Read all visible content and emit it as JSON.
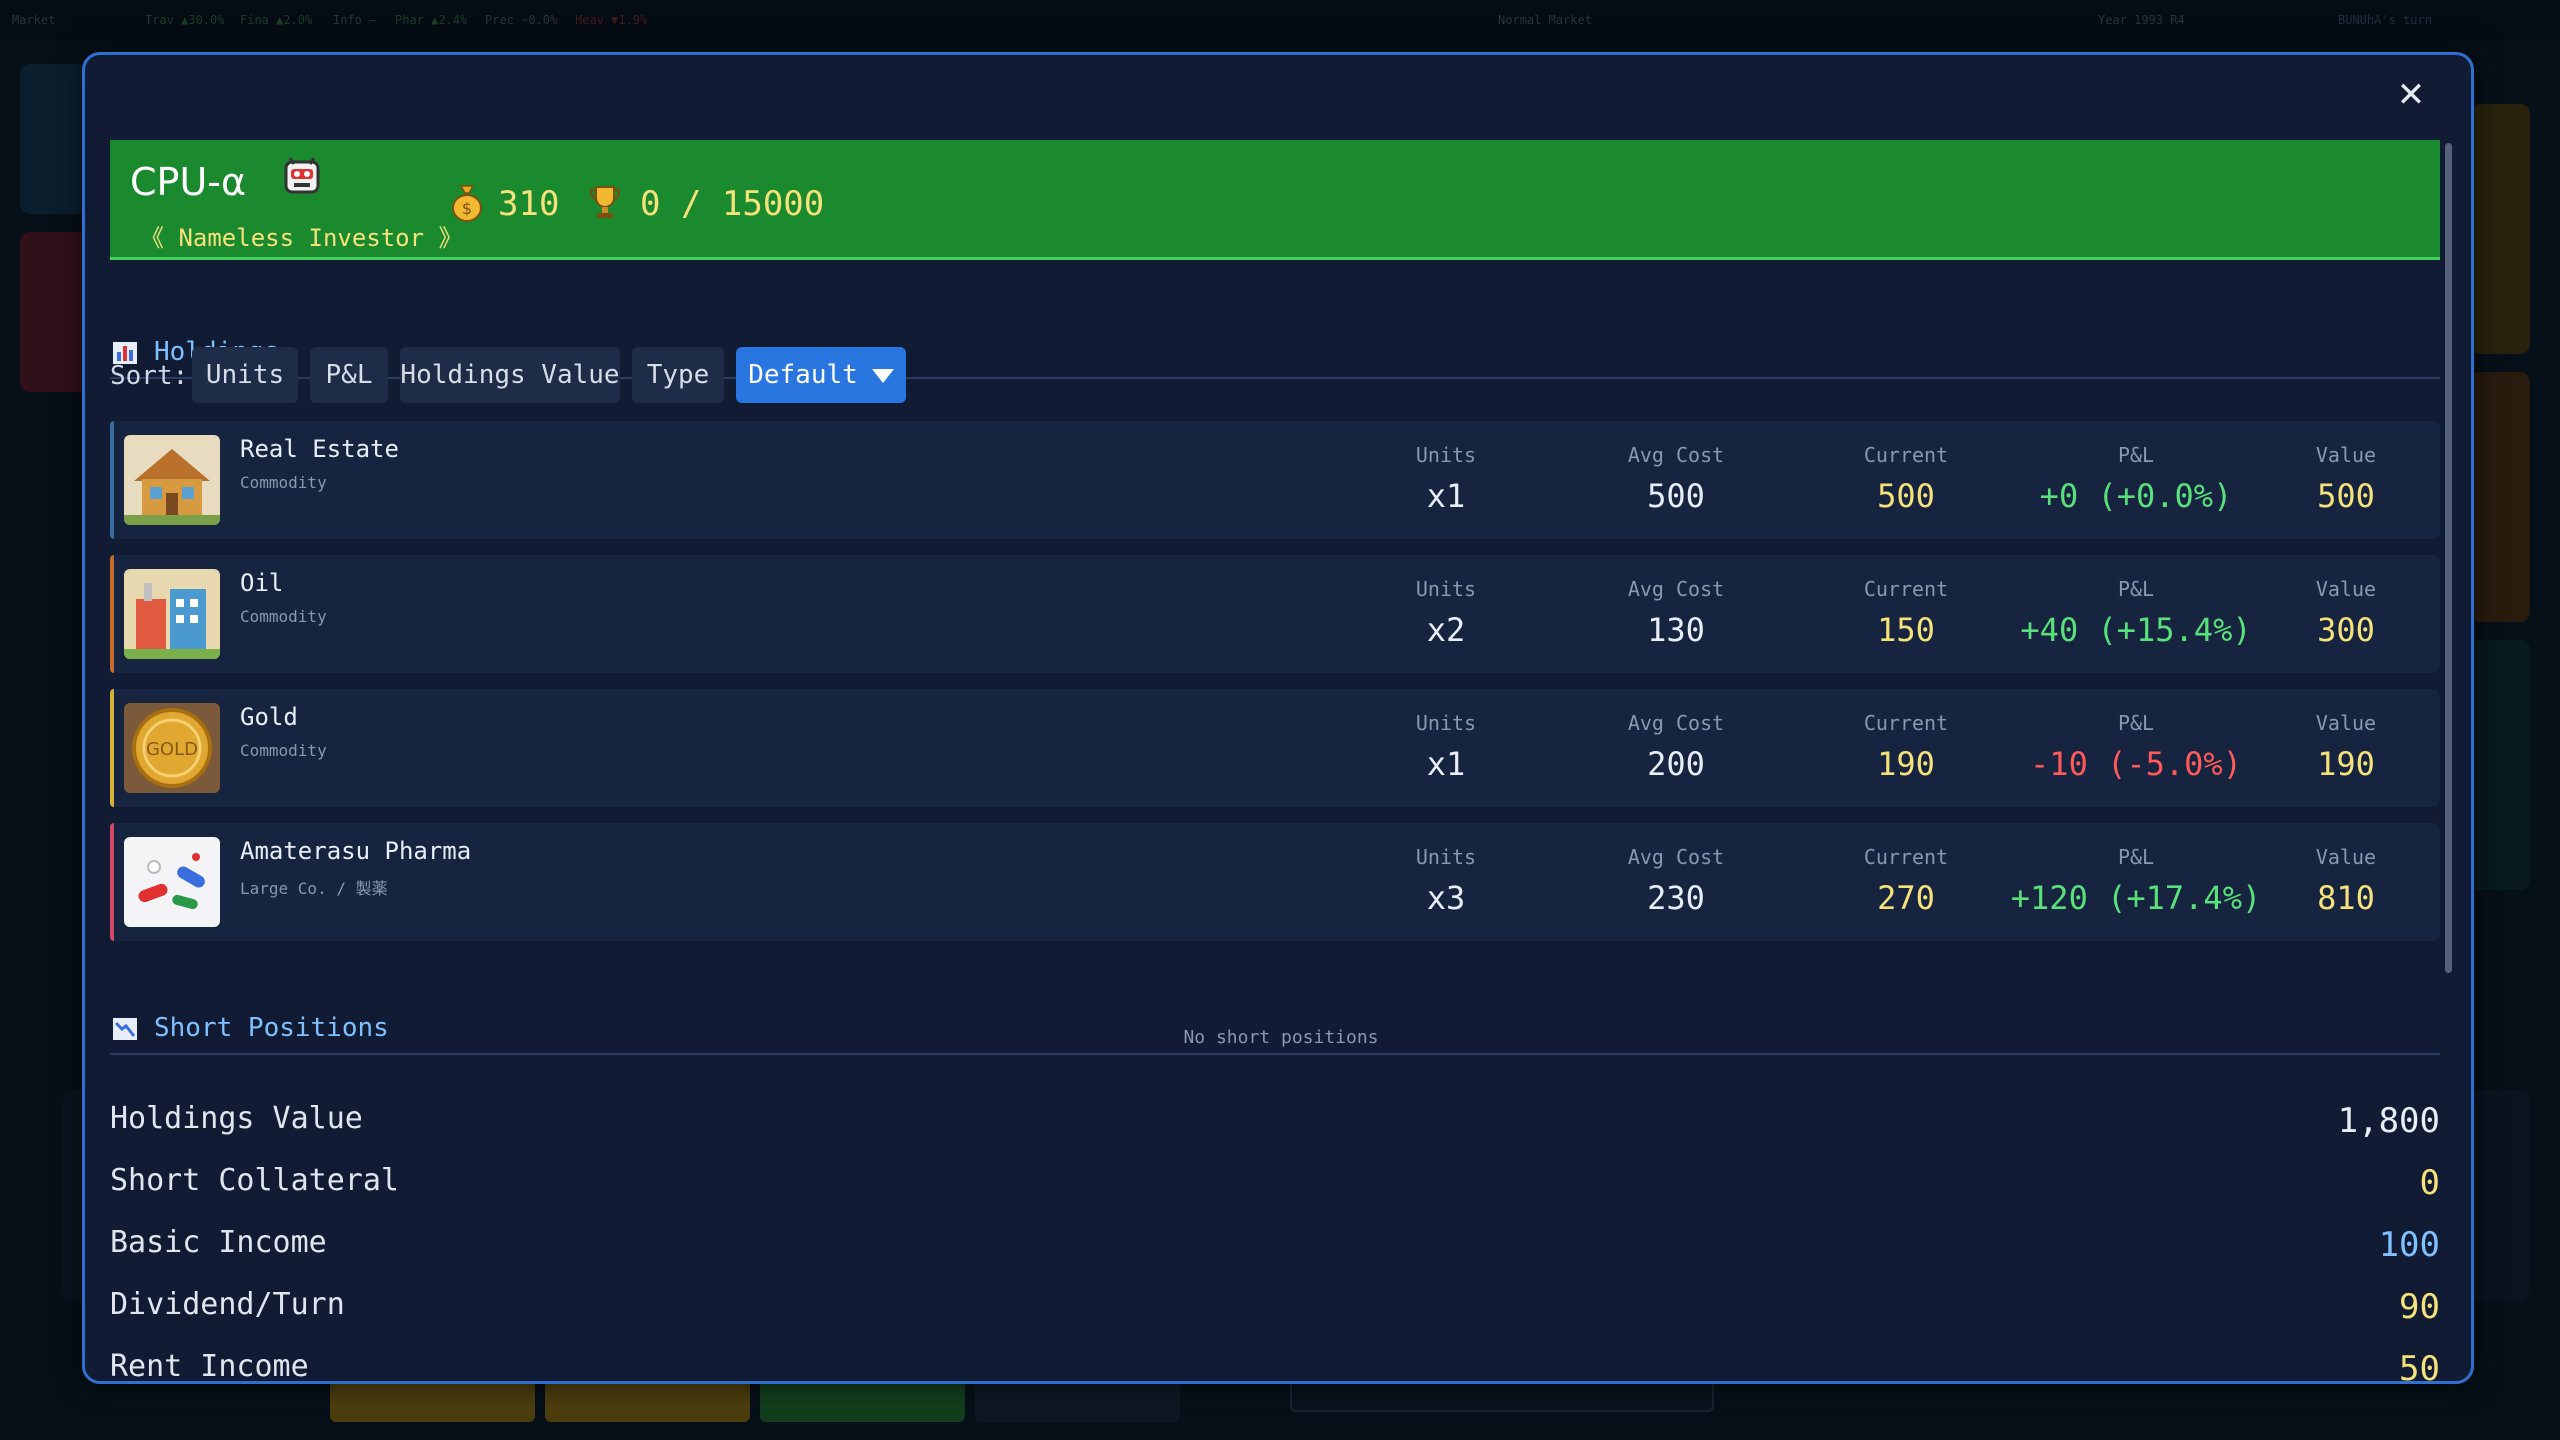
{
  "background": {
    "topbar": {
      "market": "Market",
      "tickers": [
        "Trav ▲30.0%",
        "Fina ▲2.0%",
        "Info —",
        "Phar ▲2.4%",
        "Prec −0.0%",
        "Heav ▼1.9%"
      ],
      "status": "Normal Market",
      "year": "Year 1993 R4",
      "turn": "BUNUhA's turn"
    }
  },
  "modal": {
    "close_icon": "close-icon",
    "player": {
      "name": "CPU-α",
      "title": "《 Nameless Investor 》",
      "cash": "310",
      "score": "0 / 15000"
    },
    "holdings_section": {
      "title": "Holdings",
      "icon": "bar-chart-icon"
    },
    "sort": {
      "label": "Sort:",
      "buttons": [
        "Units",
        "P&L",
        "Holdings Value",
        "Type"
      ],
      "selected": "Default"
    },
    "columns": {
      "units": "Units",
      "avg_cost": "Avg Cost",
      "current": "Current",
      "pnl": "P&L",
      "value": "Value"
    },
    "holdings": [
      {
        "name": "Real Estate",
        "category": "Commodity",
        "units": "x1",
        "avg_cost": "500",
        "current": "500",
        "pnl": "+0 (+0.0%)",
        "pnl_color": "#59e07a",
        "value": "500",
        "accent": "#3a6ea0",
        "icon": "house-icon"
      },
      {
        "name": "Oil",
        "category": "Commodity",
        "units": "x2",
        "avg_cost": "130",
        "current": "150",
        "pnl": "+40 (+15.4%)",
        "pnl_color": "#59e07a",
        "value": "300",
        "accent": "#c46a2a",
        "icon": "refinery-icon"
      },
      {
        "name": "Gold",
        "category": "Commodity",
        "units": "x1",
        "avg_cost": "200",
        "current": "190",
        "pnl": "-10 (-5.0%)",
        "pnl_color": "#ff5a5a",
        "value": "190",
        "accent": "#d6b23a",
        "icon": "gold-coin-icon"
      },
      {
        "name": "Amaterasu Pharma",
        "category": "Large Co. / 製薬",
        "units": "x3",
        "avg_cost": "230",
        "current": "270",
        "pnl": "+120 (+17.4%)",
        "pnl_color": "#59e07a",
        "value": "810",
        "accent": "#d14a6a",
        "icon": "pills-icon"
      }
    ],
    "short_section": {
      "title": "Short Positions",
      "icon": "down-chart-icon",
      "empty_text": "No short positions"
    },
    "summary": [
      {
        "label": "Holdings Value",
        "value": "1,800",
        "color": "#e8eef8"
      },
      {
        "label": "Short Collateral",
        "value": "0",
        "color": "#f5e27a"
      },
      {
        "label": "Basic Income",
        "value": "100",
        "color": "#7fc0ff"
      },
      {
        "label": "Dividend/Turn",
        "value": "90",
        "color": "#f5e27a"
      },
      {
        "label": "Rent Income",
        "value": "50",
        "color": "#f5e27a"
      }
    ]
  }
}
